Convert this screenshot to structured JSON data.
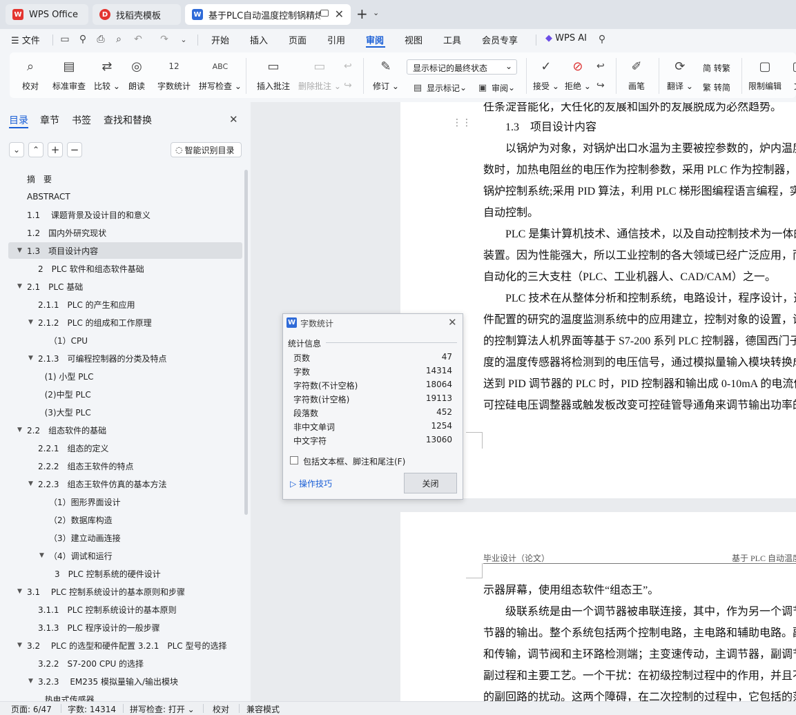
{
  "tabs": [
    {
      "label": "WPS Office",
      "color": "#e3342f",
      "logo": "W"
    },
    {
      "label": "找稻壳模板",
      "color": "#e3342f",
      "logo": "D"
    },
    {
      "label": "基于PLC自动温度控制锅精炼炉",
      "color": "#2f6bd8",
      "logo": "W"
    }
  ],
  "menu": {
    "file": "文件",
    "items": [
      "开始",
      "插入",
      "页面",
      "引用",
      "审阅",
      "视图",
      "工具",
      "会员专享"
    ],
    "active": "审阅",
    "ai": "WPS AI"
  },
  "ribbon": {
    "proof": "校对",
    "std_review": "标准审查",
    "compare": "比较",
    "read_aloud": "朗读",
    "word_count": "字数统计",
    "spell_check": "拼写检查",
    "insert_comment": "插入批注",
    "delete_comment": "删除批注",
    "revise": "修订",
    "markup_select": "显示标记的最终状态",
    "show_markup": "显示标记",
    "review": "审阅",
    "accept": "接受",
    "reject": "拒绝",
    "ink": "画笔",
    "translate": "翻译",
    "to_trad": "简 转繁",
    "to_simp": "繁 转简",
    "restrict": "限制编辑",
    "more": "文"
  },
  "sidebar": {
    "tabs": [
      "目录",
      "章节",
      "书签",
      "查找和替换"
    ],
    "active_tab": "目录",
    "smart_btn": "智能识别目录",
    "toc": [
      {
        "t": "摘　要",
        "lv": 0
      },
      {
        "t": "ABSTRACT",
        "lv": 0
      },
      {
        "t": "1.1　 课题背景及设计目的和意义",
        "lv": 0
      },
      {
        "t": "1.2　国内外研究现状",
        "lv": 0
      },
      {
        "t": "1.3　项目设计内容",
        "lv": 0,
        "arrow": true,
        "sel": true
      },
      {
        "t": "2　PLC 软件和组态软件基础",
        "lv": 1
      },
      {
        "t": "2.1　PLC 基础",
        "lv": 0,
        "arrow": true
      },
      {
        "t": "2.1.1　PLC 的产生和应用",
        "lv": 1
      },
      {
        "t": "2.1.2　PLC 的组成和工作原理",
        "lv": 1,
        "arrow": true
      },
      {
        "t": "（1）CPU",
        "lv": 2
      },
      {
        "t": "2.1.3　可编程控制器的分类及特点",
        "lv": 1,
        "arrow": true
      },
      {
        "t": "(1) 小型 PLC",
        "lv": 1.6
      },
      {
        "t": "(2)中型 PLC",
        "lv": 1.6
      },
      {
        "t": "(3)大型 PLC",
        "lv": 1.6
      },
      {
        "t": "2.2　组态软件的基础",
        "lv": 0,
        "arrow": true
      },
      {
        "t": "2.2.1　组态的定义",
        "lv": 1
      },
      {
        "t": "2.2.2　组态王软件的特点",
        "lv": 1
      },
      {
        "t": "2.2.3　组态王软件仿真的基本方法",
        "lv": 1,
        "arrow": true
      },
      {
        "t": "（1）图形界面设计",
        "lv": 2
      },
      {
        "t": "（2）数据库构造",
        "lv": 2
      },
      {
        "t": "（3）建立动画连接",
        "lv": 2
      },
      {
        "t": "（4）调试和运行",
        "lv": 2,
        "arrow": true
      },
      {
        "t": "3　PLC 控制系统的硬件设计",
        "lv": 2.5
      },
      {
        "t": "3.1　 PLC 控制系统设计的基本原则和步骤",
        "lv": 0,
        "arrow": true
      },
      {
        "t": "3.1.1　PLC 控制系统设计的基本原则",
        "lv": 1
      },
      {
        "t": "3.1.3　PLC 程序设计的一般步骤",
        "lv": 1
      },
      {
        "t": "3.2　 PLC 的选型和硬件配置 3.2.1　PLC 型号的选择",
        "lv": 0,
        "arrow": true
      },
      {
        "t": "3.2.2　S7-200 CPU 的选择",
        "lv": 1
      },
      {
        "t": "3.2.3　 EM235 模拟量输入/输出模块",
        "lv": 1,
        "arrow": true
      },
      {
        "t": "热电式传感器",
        "lv": 1.6
      }
    ]
  },
  "doc": {
    "page1": [
      "任条淀音能化，大任化的友展和国外的友展脱成为必然趋势。",
      "1.3　项目设计内容",
      "　　以锅炉为对象，对锅炉出口水温为主要被控参数的，炉内温度",
      "数时，加热电阻丝的电压作为控制参数，采用 PLC 作为控制器，",
      "锅炉控制系统;采用 PID 算法，利用 PLC 梯形图编程语言编程，实",
      "自动控制。",
      "　　PLC 是集计算机技术、通信技术，以及自动控制技术为一体的",
      "装置。因为性能强大，所以工业控制的各大领域已经广泛应用，而",
      "自动化的三大支柱（PLC、工业机器人、CAD/CAM）之一。",
      "　　PLC 技术在从整体分析和控制系统，电路设计，程序设计，选",
      "件配置的研究的温度监测系统中的应用建立，控制对象的设置，设",
      "的控制算法人机界面等基于 S7-200 系列 PLC 控制器，德国西门子",
      "度的温度传感器将检测到的电压信号，通过模拟量输入模块转换成",
      "送到 PID 调节器的 PLC 时，PID 控制器和输出成 0-10mA 的电流信",
      "可控硅电压调整器或触发板改变可控硅管导通角来调节输出功率的"
    ],
    "header_left": "毕业设计（论文）",
    "header_right": "基于 PLC 自动温度",
    "page2": [
      "示器屏幕，使用组态软件“组态王”。",
      "　　级联系统是由一个调节器被串联连接，其中，作为另一个调节",
      "节器的输出。整个系统包括两个控制电路，主电路和辅助电路。副",
      "和传输，调节阀和主环路检测端；主变速传动，主调节器，副调节",
      "副过程和主要工艺。一个干扰：在初级控制过程中的作用，并且不",
      "的副回路的扰动。这两个障碍，在二次控制的过程中，它包括的范"
    ]
  },
  "dialog": {
    "title": "字数统计",
    "section": "统计信息",
    "rows": [
      {
        "k": "页数",
        "v": "47"
      },
      {
        "k": "字数",
        "v": "14314"
      },
      {
        "k": "字符数(不计空格)",
        "v": "18064"
      },
      {
        "k": "字符数(计空格)",
        "v": "19113"
      },
      {
        "k": "段落数",
        "v": "452"
      },
      {
        "k": "非中文单词",
        "v": "1254"
      },
      {
        "k": "中文字符",
        "v": "13060"
      }
    ],
    "checkbox": "包括文本框、脚注和尾注(F)",
    "tips": "操作技巧",
    "close": "关闭"
  },
  "status": {
    "page": "页面: 6/47",
    "words": "字数: 14314",
    "spell": "拼写检查: 打开",
    "proof": "校对",
    "compat": "兼容模式"
  }
}
